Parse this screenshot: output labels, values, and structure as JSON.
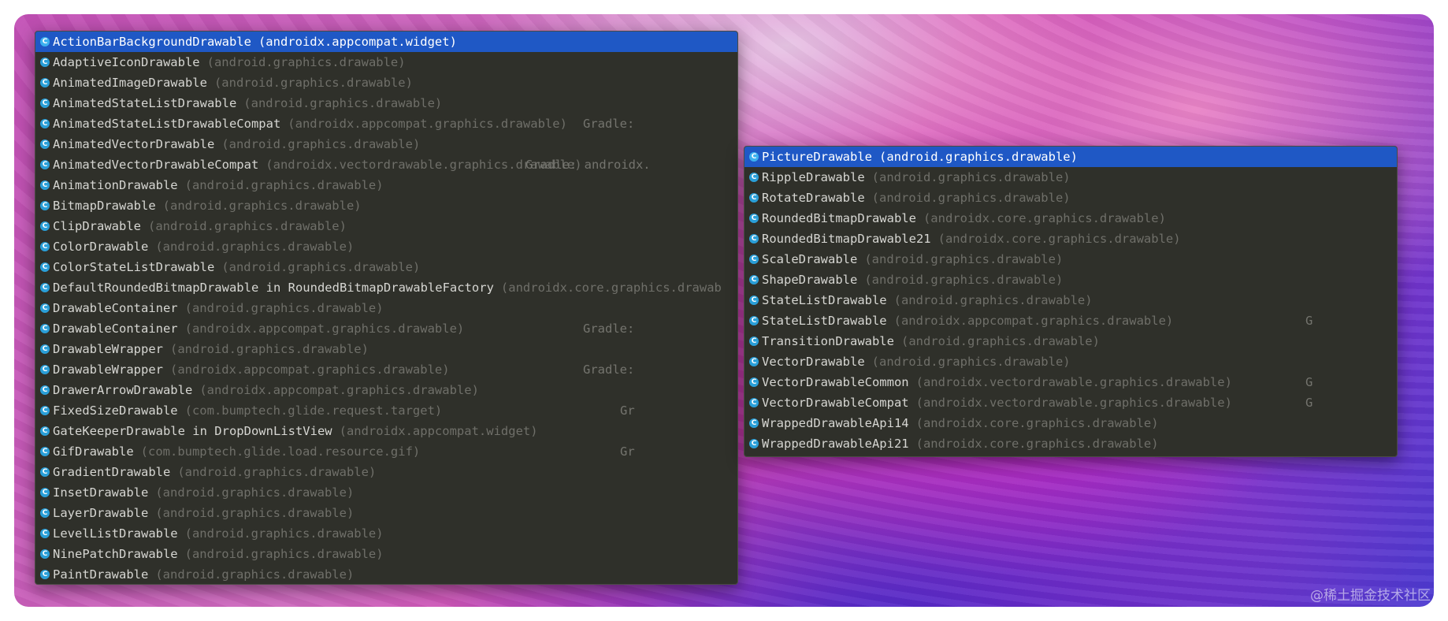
{
  "left_list": {
    "items": [
      {
        "name": "ActionBarBackgroundDrawable",
        "pkg": "(androidx.appcompat.widget)",
        "tail": "",
        "selected": true
      },
      {
        "name": "AdaptiveIconDrawable",
        "pkg": "(android.graphics.drawable)",
        "tail": ""
      },
      {
        "name": "AnimatedImageDrawable",
        "pkg": "(android.graphics.drawable)",
        "tail": ""
      },
      {
        "name": "AnimatedStateListDrawable",
        "pkg": "(android.graphics.drawable)",
        "tail": ""
      },
      {
        "name": "AnimatedStateListDrawableCompat",
        "pkg": "(androidx.appcompat.graphics.drawable)",
        "tail": "Gradle:"
      },
      {
        "name": "AnimatedVectorDrawable",
        "pkg": "(android.graphics.drawable)",
        "tail": ""
      },
      {
        "name": "AnimatedVectorDrawableCompat",
        "pkg": "(androidx.vectordrawable.graphics.drawable)",
        "tail": "Gradle: androidx."
      },
      {
        "name": "AnimationDrawable",
        "pkg": "(android.graphics.drawable)",
        "tail": ""
      },
      {
        "name": "BitmapDrawable",
        "pkg": "(android.graphics.drawable)",
        "tail": ""
      },
      {
        "name": "ClipDrawable",
        "pkg": "(android.graphics.drawable)",
        "tail": ""
      },
      {
        "name": "ColorDrawable",
        "pkg": "(android.graphics.drawable)",
        "tail": ""
      },
      {
        "name": "ColorStateListDrawable",
        "pkg": "(android.graphics.drawable)",
        "tail": ""
      },
      {
        "name": "DefaultRoundedBitmapDrawable in RoundedBitmapDrawableFactory",
        "pkg": "(androidx.core.graphics.drawab",
        "tail": ""
      },
      {
        "name": "DrawableContainer",
        "pkg": "(android.graphics.drawable)",
        "tail": ""
      },
      {
        "name": "DrawableContainer",
        "pkg": "(androidx.appcompat.graphics.drawable)",
        "tail": "Gradle:"
      },
      {
        "name": "DrawableWrapper",
        "pkg": "(android.graphics.drawable)",
        "tail": ""
      },
      {
        "name": "DrawableWrapper",
        "pkg": "(androidx.appcompat.graphics.drawable)",
        "tail": "Gradle:"
      },
      {
        "name": "DrawerArrowDrawable",
        "pkg": "(androidx.appcompat.graphics.drawable)",
        "tail": ""
      },
      {
        "name": "FixedSizeDrawable",
        "pkg": "(com.bumptech.glide.request.target)",
        "tail": "Gr"
      },
      {
        "name": "GateKeeperDrawable in DropDownListView",
        "pkg": "(androidx.appcompat.widget)",
        "tail": ""
      },
      {
        "name": "GifDrawable",
        "pkg": "(com.bumptech.glide.load.resource.gif)",
        "tail": "Gr"
      },
      {
        "name": "GradientDrawable",
        "pkg": "(android.graphics.drawable)",
        "tail": ""
      },
      {
        "name": "InsetDrawable",
        "pkg": "(android.graphics.drawable)",
        "tail": ""
      },
      {
        "name": "LayerDrawable",
        "pkg": "(android.graphics.drawable)",
        "tail": ""
      },
      {
        "name": "LevelListDrawable",
        "pkg": "(android.graphics.drawable)",
        "tail": ""
      },
      {
        "name": "NinePatchDrawable",
        "pkg": "(android.graphics.drawable)",
        "tail": ""
      },
      {
        "name": "PaintDrawable",
        "pkg": "(android.graphics.drawable)",
        "tail": ""
      }
    ]
  },
  "right_list": {
    "items": [
      {
        "name": "PictureDrawable",
        "pkg": "(android.graphics.drawable)",
        "tail": "",
        "selected": true
      },
      {
        "name": "RippleDrawable",
        "pkg": "(android.graphics.drawable)",
        "tail": ""
      },
      {
        "name": "RotateDrawable",
        "pkg": "(android.graphics.drawable)",
        "tail": ""
      },
      {
        "name": "RoundedBitmapDrawable",
        "pkg": "(androidx.core.graphics.drawable)",
        "tail": ""
      },
      {
        "name": "RoundedBitmapDrawable21",
        "pkg": "(androidx.core.graphics.drawable)",
        "tail": ""
      },
      {
        "name": "ScaleDrawable",
        "pkg": "(android.graphics.drawable)",
        "tail": ""
      },
      {
        "name": "ShapeDrawable",
        "pkg": "(android.graphics.drawable)",
        "tail": ""
      },
      {
        "name": "StateListDrawable",
        "pkg": "(android.graphics.drawable)",
        "tail": ""
      },
      {
        "name": "StateListDrawable",
        "pkg": "(androidx.appcompat.graphics.drawable)",
        "tail": "G"
      },
      {
        "name": "TransitionDrawable",
        "pkg": "(android.graphics.drawable)",
        "tail": ""
      },
      {
        "name": "VectorDrawable",
        "pkg": "(android.graphics.drawable)",
        "tail": ""
      },
      {
        "name": "VectorDrawableCommon",
        "pkg": "(androidx.vectordrawable.graphics.drawable)",
        "tail": "G"
      },
      {
        "name": "VectorDrawableCompat",
        "pkg": "(androidx.vectordrawable.graphics.drawable)",
        "tail": "G"
      },
      {
        "name": "WrappedDrawableApi14",
        "pkg": "(androidx.core.graphics.drawable)",
        "tail": ""
      },
      {
        "name": "WrappedDrawableApi21",
        "pkg": "(androidx.core.graphics.drawable)",
        "tail": ""
      }
    ]
  },
  "icon": {
    "glyph": "C",
    "name": "class-icon",
    "color": "#2a9fd8"
  },
  "watermark": "@稀土掘金技术社区",
  "colors": {
    "popup_bg": "#2f302a",
    "selected_bg": "#1f58c5",
    "name_text": "#d6d6d2",
    "pkg_text": "#6f6f69"
  }
}
